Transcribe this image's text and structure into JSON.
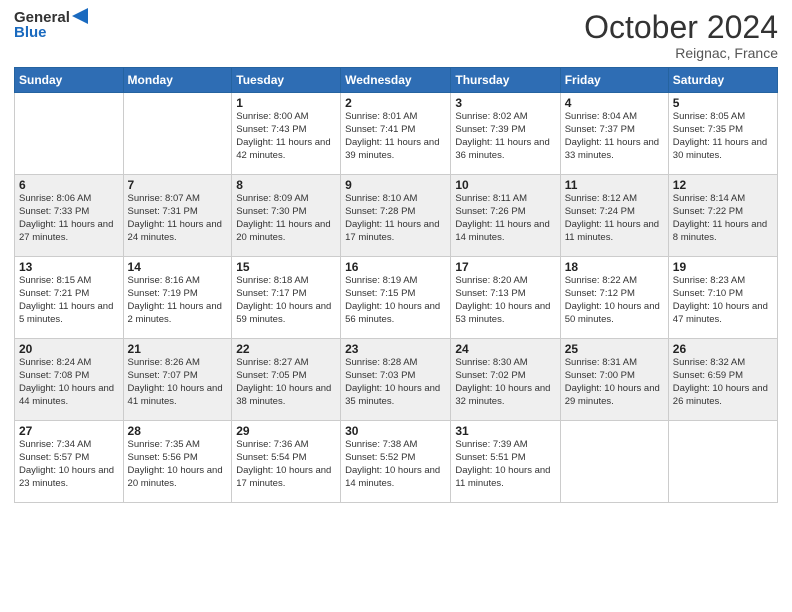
{
  "logo": {
    "general": "General",
    "blue": "Blue"
  },
  "header": {
    "month": "October 2024",
    "location": "Reignac, France"
  },
  "weekdays": [
    "Sunday",
    "Monday",
    "Tuesday",
    "Wednesday",
    "Thursday",
    "Friday",
    "Saturday"
  ],
  "weeks": [
    [
      {
        "day": "",
        "sunrise": "",
        "sunset": "",
        "daylight": ""
      },
      {
        "day": "",
        "sunrise": "",
        "sunset": "",
        "daylight": ""
      },
      {
        "day": "1",
        "sunrise": "Sunrise: 8:00 AM",
        "sunset": "Sunset: 7:43 PM",
        "daylight": "Daylight: 11 hours and 42 minutes."
      },
      {
        "day": "2",
        "sunrise": "Sunrise: 8:01 AM",
        "sunset": "Sunset: 7:41 PM",
        "daylight": "Daylight: 11 hours and 39 minutes."
      },
      {
        "day": "3",
        "sunrise": "Sunrise: 8:02 AM",
        "sunset": "Sunset: 7:39 PM",
        "daylight": "Daylight: 11 hours and 36 minutes."
      },
      {
        "day": "4",
        "sunrise": "Sunrise: 8:04 AM",
        "sunset": "Sunset: 7:37 PM",
        "daylight": "Daylight: 11 hours and 33 minutes."
      },
      {
        "day": "5",
        "sunrise": "Sunrise: 8:05 AM",
        "sunset": "Sunset: 7:35 PM",
        "daylight": "Daylight: 11 hours and 30 minutes."
      }
    ],
    [
      {
        "day": "6",
        "sunrise": "Sunrise: 8:06 AM",
        "sunset": "Sunset: 7:33 PM",
        "daylight": "Daylight: 11 hours and 27 minutes."
      },
      {
        "day": "7",
        "sunrise": "Sunrise: 8:07 AM",
        "sunset": "Sunset: 7:31 PM",
        "daylight": "Daylight: 11 hours and 24 minutes."
      },
      {
        "day": "8",
        "sunrise": "Sunrise: 8:09 AM",
        "sunset": "Sunset: 7:30 PM",
        "daylight": "Daylight: 11 hours and 20 minutes."
      },
      {
        "day": "9",
        "sunrise": "Sunrise: 8:10 AM",
        "sunset": "Sunset: 7:28 PM",
        "daylight": "Daylight: 11 hours and 17 minutes."
      },
      {
        "day": "10",
        "sunrise": "Sunrise: 8:11 AM",
        "sunset": "Sunset: 7:26 PM",
        "daylight": "Daylight: 11 hours and 14 minutes."
      },
      {
        "day": "11",
        "sunrise": "Sunrise: 8:12 AM",
        "sunset": "Sunset: 7:24 PM",
        "daylight": "Daylight: 11 hours and 11 minutes."
      },
      {
        "day": "12",
        "sunrise": "Sunrise: 8:14 AM",
        "sunset": "Sunset: 7:22 PM",
        "daylight": "Daylight: 11 hours and 8 minutes."
      }
    ],
    [
      {
        "day": "13",
        "sunrise": "Sunrise: 8:15 AM",
        "sunset": "Sunset: 7:21 PM",
        "daylight": "Daylight: 11 hours and 5 minutes."
      },
      {
        "day": "14",
        "sunrise": "Sunrise: 8:16 AM",
        "sunset": "Sunset: 7:19 PM",
        "daylight": "Daylight: 11 hours and 2 minutes."
      },
      {
        "day": "15",
        "sunrise": "Sunrise: 8:18 AM",
        "sunset": "Sunset: 7:17 PM",
        "daylight": "Daylight: 10 hours and 59 minutes."
      },
      {
        "day": "16",
        "sunrise": "Sunrise: 8:19 AM",
        "sunset": "Sunset: 7:15 PM",
        "daylight": "Daylight: 10 hours and 56 minutes."
      },
      {
        "day": "17",
        "sunrise": "Sunrise: 8:20 AM",
        "sunset": "Sunset: 7:13 PM",
        "daylight": "Daylight: 10 hours and 53 minutes."
      },
      {
        "day": "18",
        "sunrise": "Sunrise: 8:22 AM",
        "sunset": "Sunset: 7:12 PM",
        "daylight": "Daylight: 10 hours and 50 minutes."
      },
      {
        "day": "19",
        "sunrise": "Sunrise: 8:23 AM",
        "sunset": "Sunset: 7:10 PM",
        "daylight": "Daylight: 10 hours and 47 minutes."
      }
    ],
    [
      {
        "day": "20",
        "sunrise": "Sunrise: 8:24 AM",
        "sunset": "Sunset: 7:08 PM",
        "daylight": "Daylight: 10 hours and 44 minutes."
      },
      {
        "day": "21",
        "sunrise": "Sunrise: 8:26 AM",
        "sunset": "Sunset: 7:07 PM",
        "daylight": "Daylight: 10 hours and 41 minutes."
      },
      {
        "day": "22",
        "sunrise": "Sunrise: 8:27 AM",
        "sunset": "Sunset: 7:05 PM",
        "daylight": "Daylight: 10 hours and 38 minutes."
      },
      {
        "day": "23",
        "sunrise": "Sunrise: 8:28 AM",
        "sunset": "Sunset: 7:03 PM",
        "daylight": "Daylight: 10 hours and 35 minutes."
      },
      {
        "day": "24",
        "sunrise": "Sunrise: 8:30 AM",
        "sunset": "Sunset: 7:02 PM",
        "daylight": "Daylight: 10 hours and 32 minutes."
      },
      {
        "day": "25",
        "sunrise": "Sunrise: 8:31 AM",
        "sunset": "Sunset: 7:00 PM",
        "daylight": "Daylight: 10 hours and 29 minutes."
      },
      {
        "day": "26",
        "sunrise": "Sunrise: 8:32 AM",
        "sunset": "Sunset: 6:59 PM",
        "daylight": "Daylight: 10 hours and 26 minutes."
      }
    ],
    [
      {
        "day": "27",
        "sunrise": "Sunrise: 7:34 AM",
        "sunset": "Sunset: 5:57 PM",
        "daylight": "Daylight: 10 hours and 23 minutes."
      },
      {
        "day": "28",
        "sunrise": "Sunrise: 7:35 AM",
        "sunset": "Sunset: 5:56 PM",
        "daylight": "Daylight: 10 hours and 20 minutes."
      },
      {
        "day": "29",
        "sunrise": "Sunrise: 7:36 AM",
        "sunset": "Sunset: 5:54 PM",
        "daylight": "Daylight: 10 hours and 17 minutes."
      },
      {
        "day": "30",
        "sunrise": "Sunrise: 7:38 AM",
        "sunset": "Sunset: 5:52 PM",
        "daylight": "Daylight: 10 hours and 14 minutes."
      },
      {
        "day": "31",
        "sunrise": "Sunrise: 7:39 AM",
        "sunset": "Sunset: 5:51 PM",
        "daylight": "Daylight: 10 hours and 11 minutes."
      },
      {
        "day": "",
        "sunrise": "",
        "sunset": "",
        "daylight": ""
      },
      {
        "day": "",
        "sunrise": "",
        "sunset": "",
        "daylight": ""
      }
    ]
  ]
}
